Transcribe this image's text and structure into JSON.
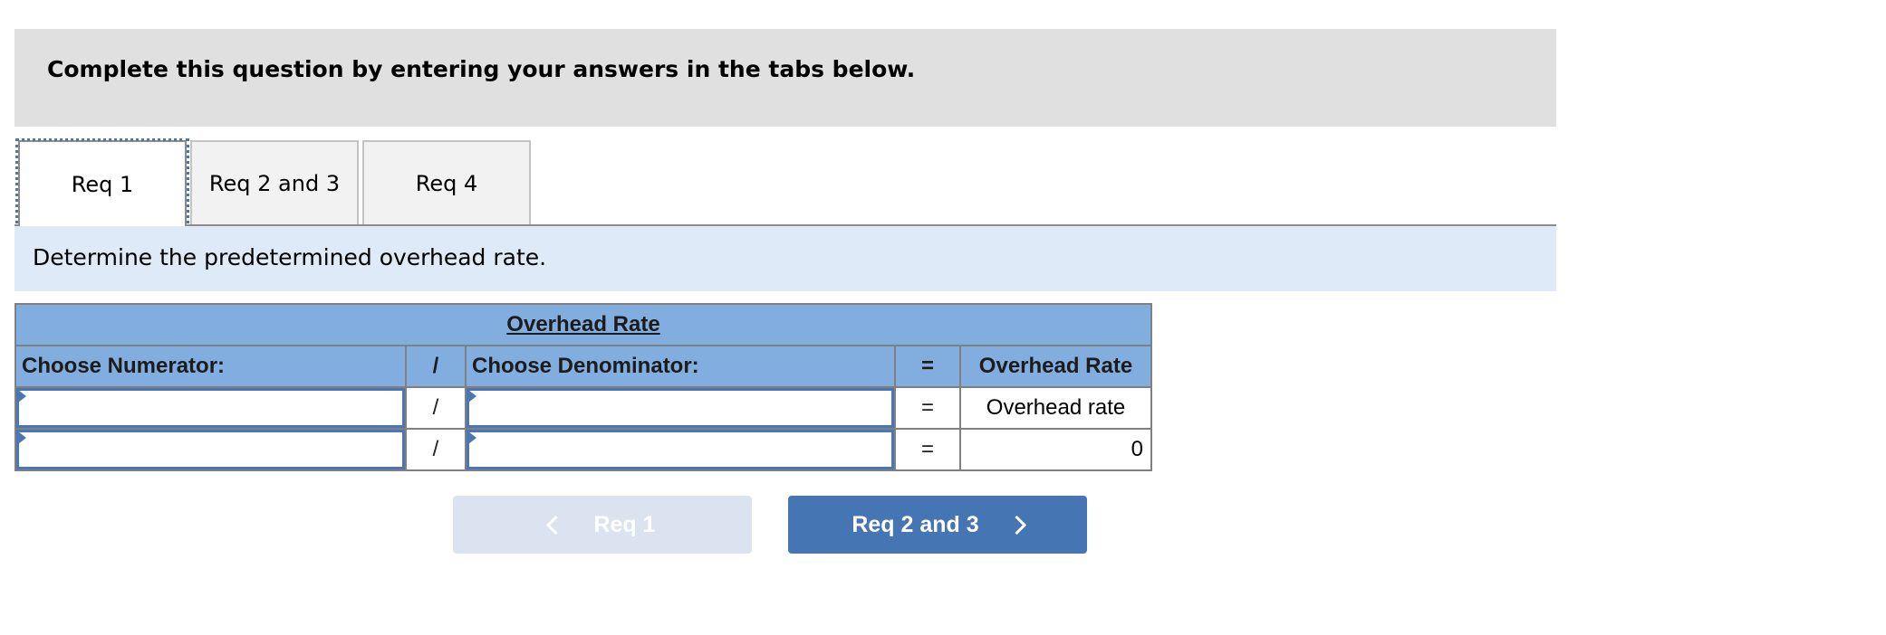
{
  "header": {
    "text": "Complete this question by entering your answers in the tabs below."
  },
  "tabs": [
    {
      "label": "Req 1",
      "active": true
    },
    {
      "label": "Req 2 and 3",
      "active": false
    },
    {
      "label": "Req 4",
      "active": false
    }
  ],
  "instruction": "Determine the predetermined overhead rate.",
  "table": {
    "title": "Overhead Rate",
    "headers": {
      "numerator": "Choose Numerator:",
      "divide": "/",
      "denominator": "Choose Denominator:",
      "equals": "=",
      "result": "Overhead Rate"
    },
    "rows": [
      {
        "numerator": "",
        "divide": "/",
        "denominator": "",
        "equals": "=",
        "result": "Overhead rate"
      },
      {
        "numerator": "",
        "divide": "/",
        "denominator": "",
        "equals": "=",
        "result": "0"
      }
    ]
  },
  "navigation": {
    "prev_label": "Req 1",
    "next_label": "Req 2 and 3",
    "prev_enabled": false
  },
  "colors": {
    "header_band": "#e0e0e0",
    "instruction_bg": "#deeaf7",
    "table_header": "#82addf",
    "input_border": "#4a76b4",
    "next_button": "#4675b3",
    "prev_button_disabled": "#dae3ef"
  }
}
